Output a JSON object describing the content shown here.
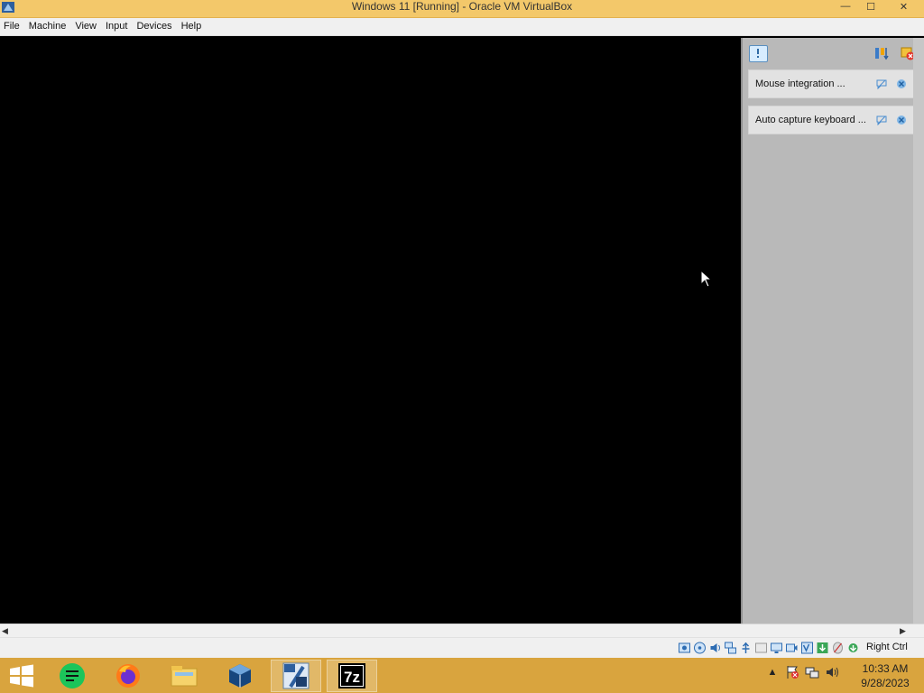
{
  "window": {
    "title": "Windows 11  [Running] - Oracle VM VirtualBox",
    "app_icon": "virtualbox-icon",
    "controls": {
      "minimize": "—",
      "maximize": "☐",
      "close": "✕"
    }
  },
  "menu": [
    "File",
    "Machine",
    "View",
    "Input",
    "Devices",
    "Help"
  ],
  "notifications": {
    "items": [
      {
        "text": "Mouse integration ..."
      },
      {
        "text": "Auto capture keyboard ..."
      }
    ]
  },
  "statusbar": {
    "icons": [
      "hard-disk-icon",
      "optical-disk-icon",
      "audio-icon",
      "network-icon",
      "usb-icon",
      "shared-folders-icon",
      "display-icon",
      "video-capture-icon",
      "virtualization-icon",
      "guest-additions-icon",
      "mouse-integration-icon",
      "keyboard-capture-icon"
    ],
    "host_key": "Right Ctrl"
  },
  "taskbar": {
    "items": [
      "start-icon",
      "notes-app-icon",
      "firefox-icon",
      "file-explorer-icon",
      "virtualbox-icon",
      "windows-11-vm-icon",
      "7zip-icon"
    ],
    "clock_time": "10:33 AM",
    "clock_date": "9/28/2023",
    "tray": [
      "show-hidden-icons",
      "action-center-icon",
      "network-tray-icon",
      "volume-icon"
    ]
  },
  "colors": {
    "titlebar": "#f3c86a",
    "taskbar": "#d9a43e",
    "panel": "#b9b9b9"
  }
}
